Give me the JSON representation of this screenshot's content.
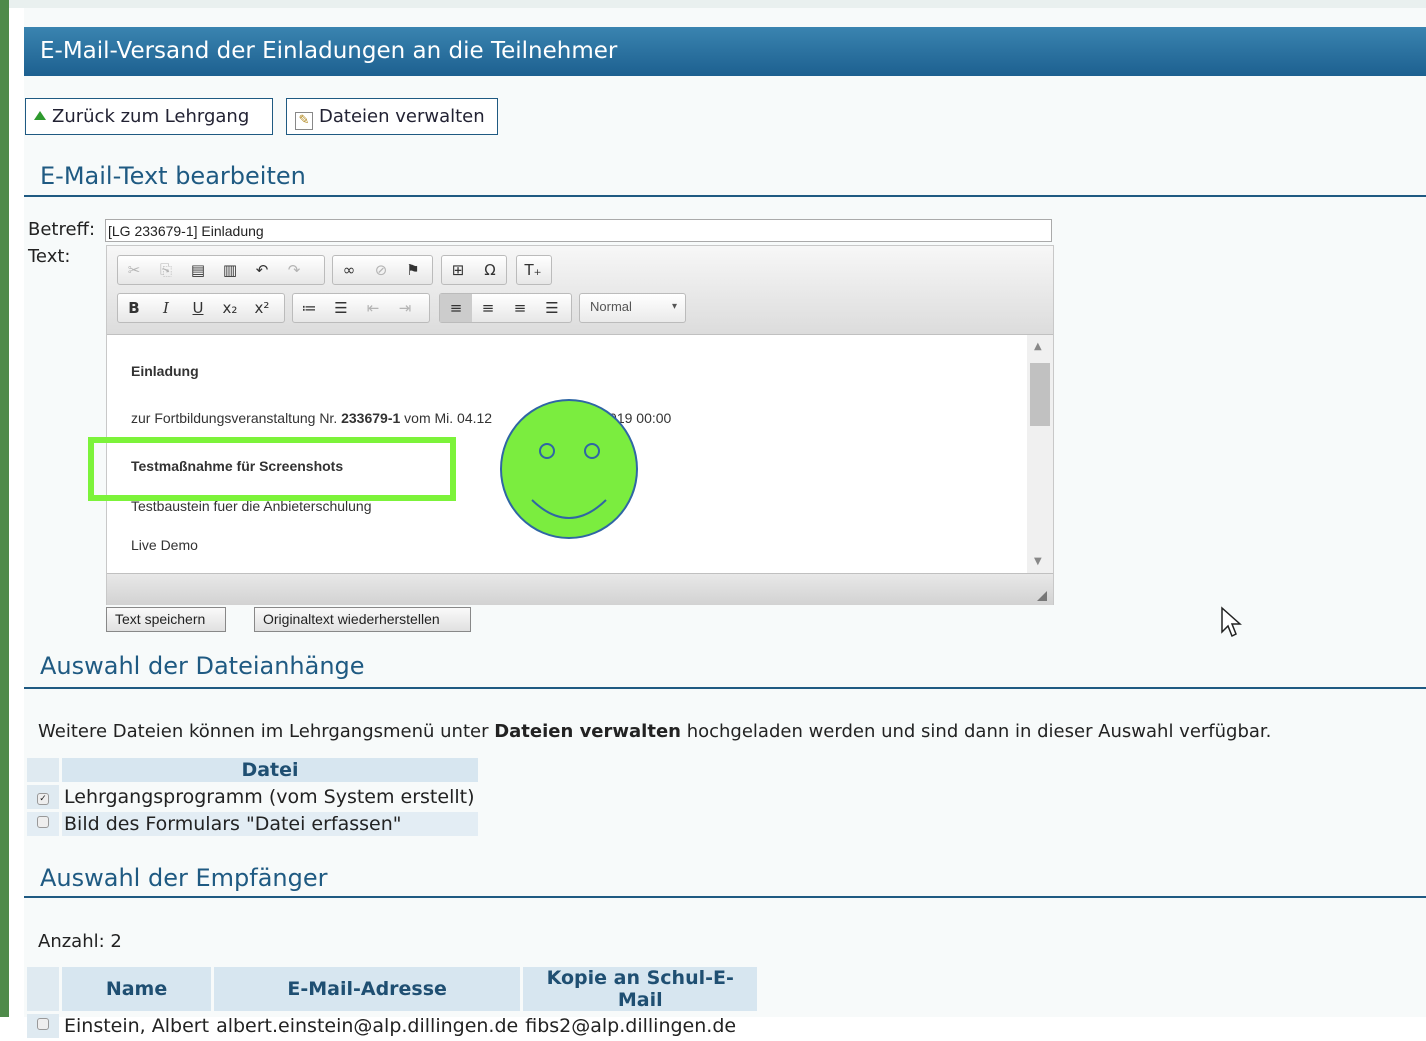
{
  "header": {
    "title": "E-Mail-Versand der Einladungen an die Teilnehmer"
  },
  "toolbar": {
    "back_label": "Zurück zum Lehrgang",
    "files_label": "Dateien verwalten"
  },
  "section_edit": {
    "title": "E-Mail-Text bearbeiten"
  },
  "form": {
    "subject_label": "Betreff:",
    "subject_value": "[LG 233679-1] Einladung",
    "text_label": "Text:"
  },
  "editor": {
    "format_value": "Normal",
    "content": {
      "line1": "Einladung",
      "line2_prefix": "zur Fortbildungsveranstaltung Nr. ",
      "line2_number": "233679-1",
      "line2_mid": " vom Mi. 04.12",
      "line2_suffix": "is Fr. 06.12.2019 00:00",
      "line3": "Testmaßnahme für Screenshots",
      "line4": "Testbaustein fuer die Anbieterschulung",
      "line5": "Live Demo"
    }
  },
  "buttons": {
    "save_text": "Text speichern",
    "restore_text": "Originaltext wiederherstellen"
  },
  "section_attachments": {
    "title": "Auswahl der Dateianhänge",
    "info_prefix": "Weitere Dateien können im Lehrgangsmenü unter ",
    "info_bold": "Dateien verwalten",
    "info_suffix": " hochgeladen werden und sind dann in dieser Auswahl verfügbar.",
    "column_header": "Datei",
    "files": [
      {
        "name": "Lehrgangsprogramm (vom System erstellt)",
        "checked": true
      },
      {
        "name": "Bild des Formulars \"Datei erfassen\"",
        "checked": false
      }
    ]
  },
  "section_recipients": {
    "title": "Auswahl der Empfänger",
    "count_label": "Anzahl: 2",
    "columns": [
      "Name",
      "E-Mail-Adresse",
      "Kopie an Schul-E-Mail"
    ],
    "rows": [
      {
        "name": "Einstein, Albert",
        "email": "albert.einstein@alp.dillingen.de",
        "copy": "fibs2@alp.dillingen.de"
      }
    ]
  }
}
